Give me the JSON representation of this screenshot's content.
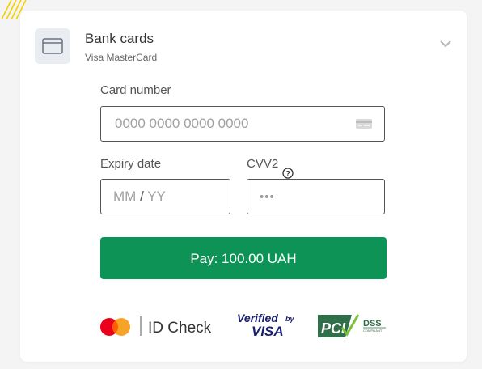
{
  "payment_method": {
    "title": "Bank cards",
    "subtitle": "Visa MasterCard",
    "icon": "card-icon",
    "chevron_icon": "chevron-down-icon"
  },
  "card_number": {
    "label": "Card number",
    "placeholder": "0000 0000 0000 0000",
    "icon": "card-small-icon"
  },
  "expiry": {
    "label": "Expiry date",
    "month_placeholder": "MM",
    "separator": "/",
    "year_placeholder": "YY"
  },
  "cvv": {
    "label": "CVV2",
    "placeholder": "•••",
    "help_icon": "question-circle-icon"
  },
  "pay_button": {
    "label": "Pay: 100.00 UAH",
    "color": "#0d9356"
  },
  "badges": {
    "id_check": "ID Check",
    "verified_top": "Verified",
    "verified_by": "by",
    "verified_brand": "VISA",
    "pci_text": "PCI",
    "dss_text": "DSS",
    "compliant_text": "COMPLIANT"
  },
  "colors": {
    "mastercard_red": "#eb001b",
    "mastercard_orange": "#f79e1b",
    "visa_blue": "#1a1f71",
    "pci_green": "#2f6f4a"
  }
}
